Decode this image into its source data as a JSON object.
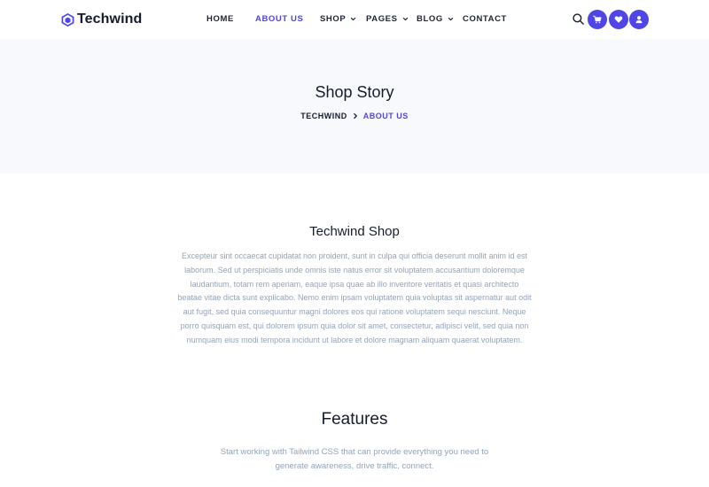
{
  "brand": {
    "name": "Techwind"
  },
  "nav": {
    "items": [
      {
        "label": "Home"
      },
      {
        "label": "About Us"
      },
      {
        "label": "Shop"
      },
      {
        "label": "Pages"
      },
      {
        "label": "Blog"
      },
      {
        "label": "Contact"
      }
    ],
    "icons": [
      "search-icon",
      "cart-icon",
      "heart-icon",
      "user-icon"
    ]
  },
  "hero": {
    "title": "Shop Story",
    "breadcrumb": [
      "Techwind",
      "About Us"
    ]
  },
  "shop": {
    "title": "Techwind Shop",
    "text": "Excepteur sint occaecat cupidatat non proident, sunt in culpa qui officia deserunt mollit anim id est laborum. Sed ut perspiciatis unde omnis iste natus error sit voluptatem accusantium doloremque laudantium, totam rem aperiam, eaque ipsa quae ab illo inventore veritatis et quasi architecto beatae vitae dicta sunt explicabo. Nemo enim ipsam voluptatem quia voluptas sit aspernatur aut odit aut fugit, sed quia consequuntur magni dolores eos qui ratione voluptatem sequi nesciunt. Neque porro quisquam est, qui dolorem ipsum quia dolor sit amet, consectetur, adipisci velit, sed quia non numquam eius modi tempora incidunt ut labore et dolore magnam aliquam quaerat voluptatem."
  },
  "features": {
    "title": "Features",
    "text": "Start working with Tailwind CSS that can provide everything you need to generate awareness, drive traffic, connect."
  },
  "colors": {
    "accent": "#4f46e5",
    "hero_bg": "#f8f9fc",
    "text_dark": "#161c2d",
    "text_muted": "#94a3b8"
  }
}
